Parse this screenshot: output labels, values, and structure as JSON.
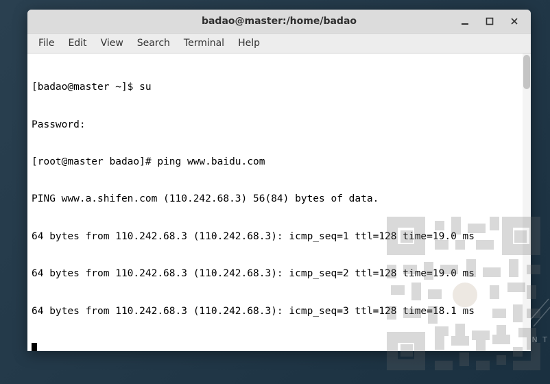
{
  "titlebar": {
    "title": "badao@master:/home/badao"
  },
  "menubar": {
    "items": [
      "File",
      "Edit",
      "View",
      "Search",
      "Terminal",
      "Help"
    ]
  },
  "terminal": {
    "lines": [
      "[badao@master ~]$ su",
      "Password:",
      "[root@master badao]# ping www.baidu.com",
      "PING www.a.shifen.com (110.242.68.3) 56(84) bytes of data.",
      "64 bytes from 110.242.68.3 (110.242.68.3): icmp_seq=1 ttl=128 time=19.0 ms",
      "64 bytes from 110.242.68.3 (110.242.68.3): icmp_seq=2 ttl=128 time=19.0 ms",
      "64 bytes from 110.242.68.3 (110.242.68.3): icmp_seq=3 ttl=128 time=18.1 ms"
    ]
  },
  "watermark_side": "N T"
}
